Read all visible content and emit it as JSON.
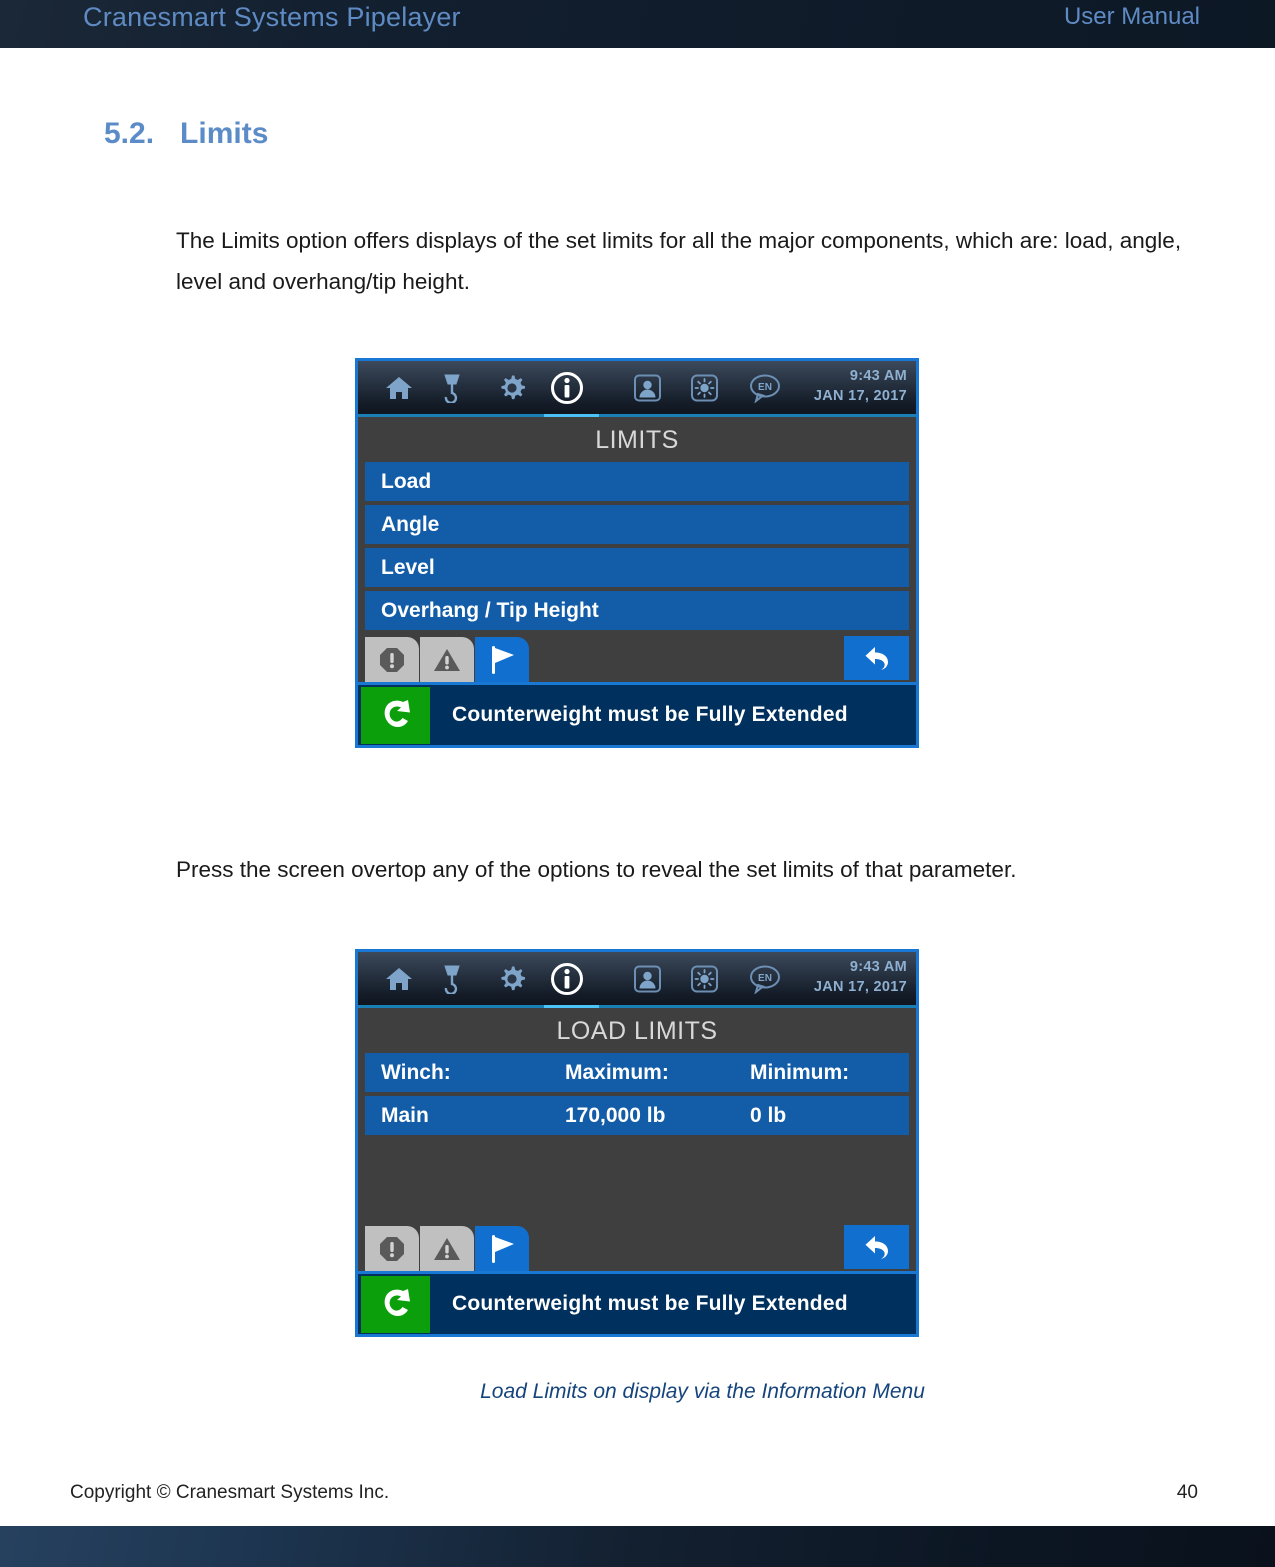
{
  "header": {
    "title": "Cranesmart Systems Pipelayer",
    "right_label": "User Manual"
  },
  "section": {
    "number": "5.2.",
    "title": "Limits"
  },
  "paragraphs": {
    "intro": "The Limits option offers displays of the set limits for all the major components, which are: load, angle, level and overhang/tip height.",
    "press": "Press the screen overtop any of the options to reveal the set limits of that parameter."
  },
  "screenshot_1": {
    "toolbar": {
      "icons": [
        {
          "name": "home-icon",
          "label": "Home"
        },
        {
          "name": "hook-icon",
          "label": "Load Cell"
        },
        {
          "name": "gear-icon",
          "label": "Settings"
        },
        {
          "name": "info-icon",
          "label": "Information"
        },
        {
          "name": "user-icon",
          "label": "Operator"
        },
        {
          "name": "brightness-icon",
          "label": "Brightness"
        },
        {
          "name": "language-icon",
          "label": "EN"
        }
      ],
      "language_code": "EN",
      "time": "9:43 AM",
      "date": "JAN 17, 2017"
    },
    "screen_title": "LIMITS",
    "menu_items": [
      "Load",
      "Angle",
      "Level",
      "Overhang / Tip Height"
    ],
    "tabs": [
      {
        "name": "error-tab",
        "icon": "error-octagon-icon"
      },
      {
        "name": "warning-tab",
        "icon": "warning-triangle-icon"
      },
      {
        "name": "flag-tab",
        "icon": "flag-icon",
        "active": true
      }
    ],
    "back_button": {
      "name": "back-button",
      "icon": "back-arrow-icon"
    },
    "status": {
      "icon": "rotate-arrow-icon",
      "message": "Counterweight must be Fully Extended"
    }
  },
  "screenshot_2": {
    "toolbar": {
      "language_code": "EN",
      "time": "9:43 AM",
      "date": "JAN 17, 2017"
    },
    "screen_title": "LOAD LIMITS",
    "table": {
      "headers": [
        "Winch:",
        "Maximum:",
        "Minimum:"
      ],
      "rows": [
        [
          "Main",
          "170,000 lb",
          "0 lb"
        ]
      ]
    },
    "tabs": [
      {
        "name": "error-tab",
        "icon": "error-octagon-icon"
      },
      {
        "name": "warning-tab",
        "icon": "warning-triangle-icon"
      },
      {
        "name": "flag-tab",
        "icon": "flag-icon",
        "active": true
      }
    ],
    "back_button": {
      "name": "back-button",
      "icon": "back-arrow-icon"
    },
    "status": {
      "icon": "rotate-arrow-icon",
      "message": "Counterweight must be Fully Extended"
    }
  },
  "caption": "Load Limits on display via the Information Menu",
  "footer": {
    "copyright": "Copyright © Cranesmart Systems Inc.",
    "page_number": "40"
  },
  "colors": {
    "header_bg": "#101c2b",
    "heading_blue": "#5b8cc8",
    "device_border": "#1878d4",
    "menu_blue": "#125ca8",
    "status_bg": "#00305e",
    "status_icon_green": "#0ba00b",
    "caption_blue": "#15447c"
  }
}
